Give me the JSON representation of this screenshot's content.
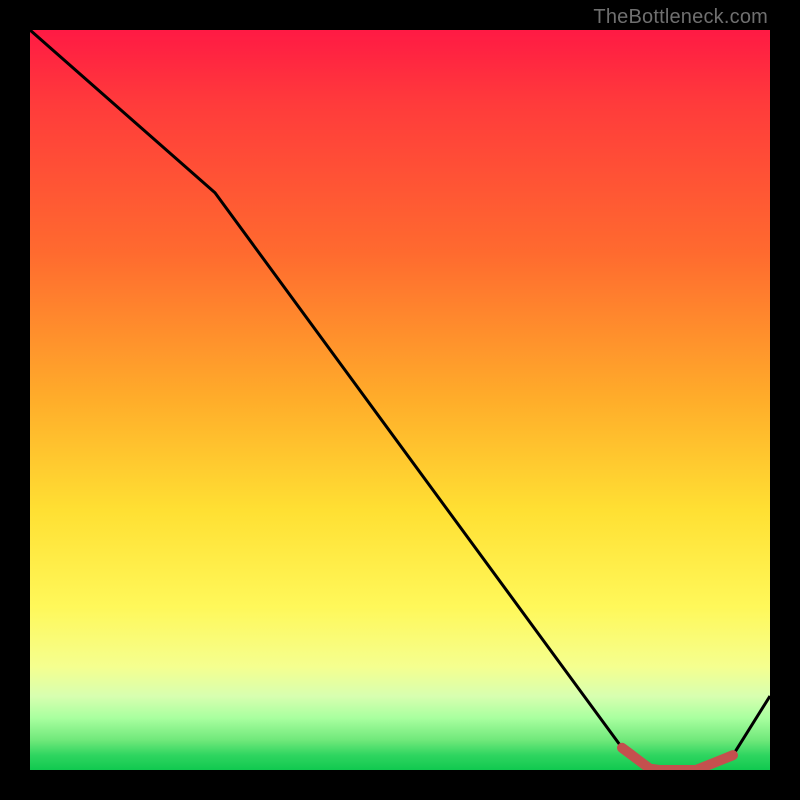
{
  "attribution": "TheBottleneck.com",
  "chart_data": {
    "type": "line",
    "title": "",
    "xlabel": "",
    "ylabel": "",
    "xlim": [
      0,
      100
    ],
    "ylim": [
      0,
      100
    ],
    "grid": false,
    "legend": false,
    "series": [
      {
        "name": "curve",
        "x": [
          0,
          25,
          80,
          84,
          90,
          95,
          100
        ],
        "values": [
          100,
          78,
          3,
          0,
          0,
          2,
          10
        ]
      }
    ],
    "highlight_band": {
      "x_start": 80,
      "x_end": 95,
      "color": "#c4504e"
    }
  },
  "colors": {
    "curve": "#000000",
    "highlight": "#c4504e",
    "background_frame": "#000000"
  }
}
